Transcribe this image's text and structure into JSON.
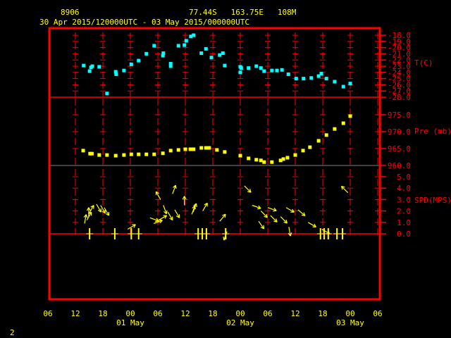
{
  "header": {
    "station": "8906",
    "location": "77.44S   163.75E   108M",
    "period": "30 Apr 2015/120000UTC - 03 May 2015/000000UTC"
  },
  "footer": {
    "page_number": "2"
  },
  "colors": {
    "frame": "#ff0000",
    "temperature": "#00ffff",
    "pressure": "#ffff00",
    "wind": "#ffff00",
    "labels": "#ffff00"
  },
  "chart_data": {
    "type": "scatter",
    "time_reference": "hours since 30 Apr 2015 12UTC",
    "x_ticks": [
      "06",
      "12",
      "18",
      "00",
      "06",
      "12",
      "18",
      "00",
      "06",
      "12",
      "18",
      "00",
      "06"
    ],
    "x_tick_hours": [
      -6,
      0,
      6,
      12,
      18,
      24,
      30,
      36,
      42,
      48,
      54,
      60,
      66
    ],
    "date_labels": [
      {
        "text": "01 May",
        "hour": 12
      },
      {
        "text": "02 May",
        "hour": 36
      },
      {
        "text": "03 May",
        "hour": 60
      }
    ],
    "panels": [
      {
        "name": "temperature",
        "label": "T(C)",
        "ylim": [
          -28,
          -18
        ],
        "ticks": [
          "-18.0",
          "-19.0",
          "-20.0",
          "-21.0",
          "-22.0",
          "-23.0",
          "-24.0",
          "-25.0",
          "-26.0",
          "-27.0",
          "-28.0"
        ],
        "points": [
          [
            1.8,
            -22.9
          ],
          [
            3.1,
            -23.8
          ],
          [
            3.4,
            -23.2
          ],
          [
            3.7,
            -23.0
          ],
          [
            5.2,
            -23.1
          ],
          [
            6.9,
            -27.4
          ],
          [
            8.8,
            -23.9
          ],
          [
            8.9,
            -24.3
          ],
          [
            10.6,
            -23.7
          ],
          [
            12.2,
            -22.7
          ],
          [
            13.8,
            -22.1
          ],
          [
            15.5,
            -21.0
          ],
          [
            17.2,
            -19.7
          ],
          [
            19.1,
            -21.3
          ],
          [
            19.2,
            -20.9
          ],
          [
            20.8,
            -23.0
          ],
          [
            20.8,
            -22.6
          ],
          [
            22.5,
            -19.7
          ],
          [
            23.8,
            -19.6
          ],
          [
            24.2,
            -18.9
          ],
          [
            25.2,
            -18.2
          ],
          [
            25.8,
            -18.0
          ],
          [
            27.5,
            -20.9
          ],
          [
            28.5,
            -20.2
          ],
          [
            29.7,
            -21.6
          ],
          [
            31.5,
            -21.2
          ],
          [
            32.2,
            -20.9
          ],
          [
            32.6,
            -22.9
          ],
          [
            36.0,
            -24.0
          ],
          [
            36.0,
            -23.1
          ],
          [
            36.2,
            -23.3
          ],
          [
            37.8,
            -23.3
          ],
          [
            39.5,
            -23.0
          ],
          [
            40.5,
            -23.3
          ],
          [
            41.2,
            -23.8
          ],
          [
            42.9,
            -23.7
          ],
          [
            44.0,
            -23.7
          ],
          [
            45.1,
            -23.6
          ],
          [
            46.5,
            -24.3
          ],
          [
            48.2,
            -25.0
          ],
          [
            49.8,
            -25.0
          ],
          [
            51.5,
            -24.9
          ],
          [
            53.1,
            -24.6
          ],
          [
            53.7,
            -24.2
          ],
          [
            54.8,
            -25.0
          ],
          [
            56.6,
            -25.5
          ],
          [
            58.5,
            -26.3
          ],
          [
            60.0,
            -25.8
          ]
        ]
      },
      {
        "name": "pressure",
        "label": "Pre (mb)",
        "ylim": [
          960,
          975
        ],
        "ticks": [
          "975.0",
          "970.0",
          "965.0",
          "960.0"
        ],
        "points": [
          [
            1.7,
            964.4
          ],
          [
            3.2,
            963.5
          ],
          [
            3.6,
            963.5
          ],
          [
            5.2,
            963.1
          ],
          [
            6.9,
            963.1
          ],
          [
            8.8,
            962.9
          ],
          [
            10.6,
            963.1
          ],
          [
            12.2,
            963.3
          ],
          [
            13.8,
            963.3
          ],
          [
            15.5,
            963.3
          ],
          [
            17.2,
            963.3
          ],
          [
            19.1,
            963.6
          ],
          [
            20.8,
            964.4
          ],
          [
            22.5,
            964.6
          ],
          [
            24.0,
            964.8
          ],
          [
            25.1,
            964.8
          ],
          [
            25.8,
            964.8
          ],
          [
            27.5,
            965.2
          ],
          [
            28.5,
            965.2
          ],
          [
            29.2,
            965.2
          ],
          [
            30.9,
            964.6
          ],
          [
            32.6,
            964.0
          ],
          [
            36.0,
            962.9
          ],
          [
            37.8,
            962.1
          ],
          [
            39.5,
            961.7
          ],
          [
            40.5,
            961.5
          ],
          [
            41.2,
            961.0
          ],
          [
            42.9,
            961.0
          ],
          [
            44.8,
            961.5
          ],
          [
            45.4,
            961.9
          ],
          [
            46.3,
            962.3
          ],
          [
            48.0,
            963.1
          ],
          [
            49.7,
            964.4
          ],
          [
            51.2,
            965.4
          ],
          [
            53.1,
            967.3
          ],
          [
            54.8,
            969.0
          ],
          [
            56.6,
            970.8
          ],
          [
            58.5,
            972.5
          ],
          [
            60.0,
            974.6
          ]
        ]
      },
      {
        "name": "wind_speed",
        "label": "SPD(MPS)",
        "ylim": [
          0,
          5
        ],
        "ticks": [
          "5.0",
          "4.0",
          "3.0",
          "2.0",
          "1.0",
          "0.0"
        ],
        "arrows_hour_speed_direction": [
          [
            2.0,
            0.9,
            10
          ],
          [
            2.5,
            1.2,
            30
          ],
          [
            2.9,
            1.5,
            0
          ],
          [
            3.0,
            1.8,
            30
          ],
          [
            4.6,
            2.6,
            150
          ],
          [
            5.5,
            2.5,
            150
          ],
          [
            6.3,
            2.3,
            150
          ],
          [
            11.4,
            0.4,
            60
          ],
          [
            16.3,
            1.4,
            110
          ],
          [
            17.1,
            0.9,
            70
          ],
          [
            18.2,
            1.2,
            60
          ],
          [
            18.6,
            3.0,
            330
          ],
          [
            19.2,
            2.5,
            160
          ],
          [
            21.2,
            3.5,
            20
          ],
          [
            20.2,
            1.9,
            150
          ],
          [
            21.7,
            2.1,
            150
          ],
          [
            23.8,
            2.5,
            0
          ],
          [
            25.7,
            1.9,
            20
          ],
          [
            25.4,
            1.7,
            20
          ],
          [
            27.8,
            2.0,
            30
          ],
          [
            31.5,
            1.1,
            40
          ],
          [
            33.1,
            0.2,
            200
          ],
          [
            36.9,
            4.2,
            135
          ],
          [
            38.6,
            2.5,
            110
          ],
          [
            42.0,
            2.3,
            110
          ],
          [
            40.5,
            2.0,
            135
          ],
          [
            42.6,
            1.6,
            135
          ],
          [
            40.0,
            1.1,
            145
          ],
          [
            46.0,
            2.3,
            120
          ],
          [
            44.8,
            1.5,
            135
          ],
          [
            46.6,
            0.6,
            170
          ],
          [
            48.6,
            2.1,
            130
          ],
          [
            50.8,
            1.0,
            120
          ],
          [
            53.8,
            0.4,
            120
          ],
          [
            59.5,
            3.6,
            315
          ]
        ],
        "calm_hours": [
          3.1,
          8.6,
          12.2,
          13.8,
          26.8,
          27.7,
          28.6,
          32.8,
          53.5,
          54.3,
          55.2,
          57.1,
          58.3
        ]
      }
    ]
  }
}
